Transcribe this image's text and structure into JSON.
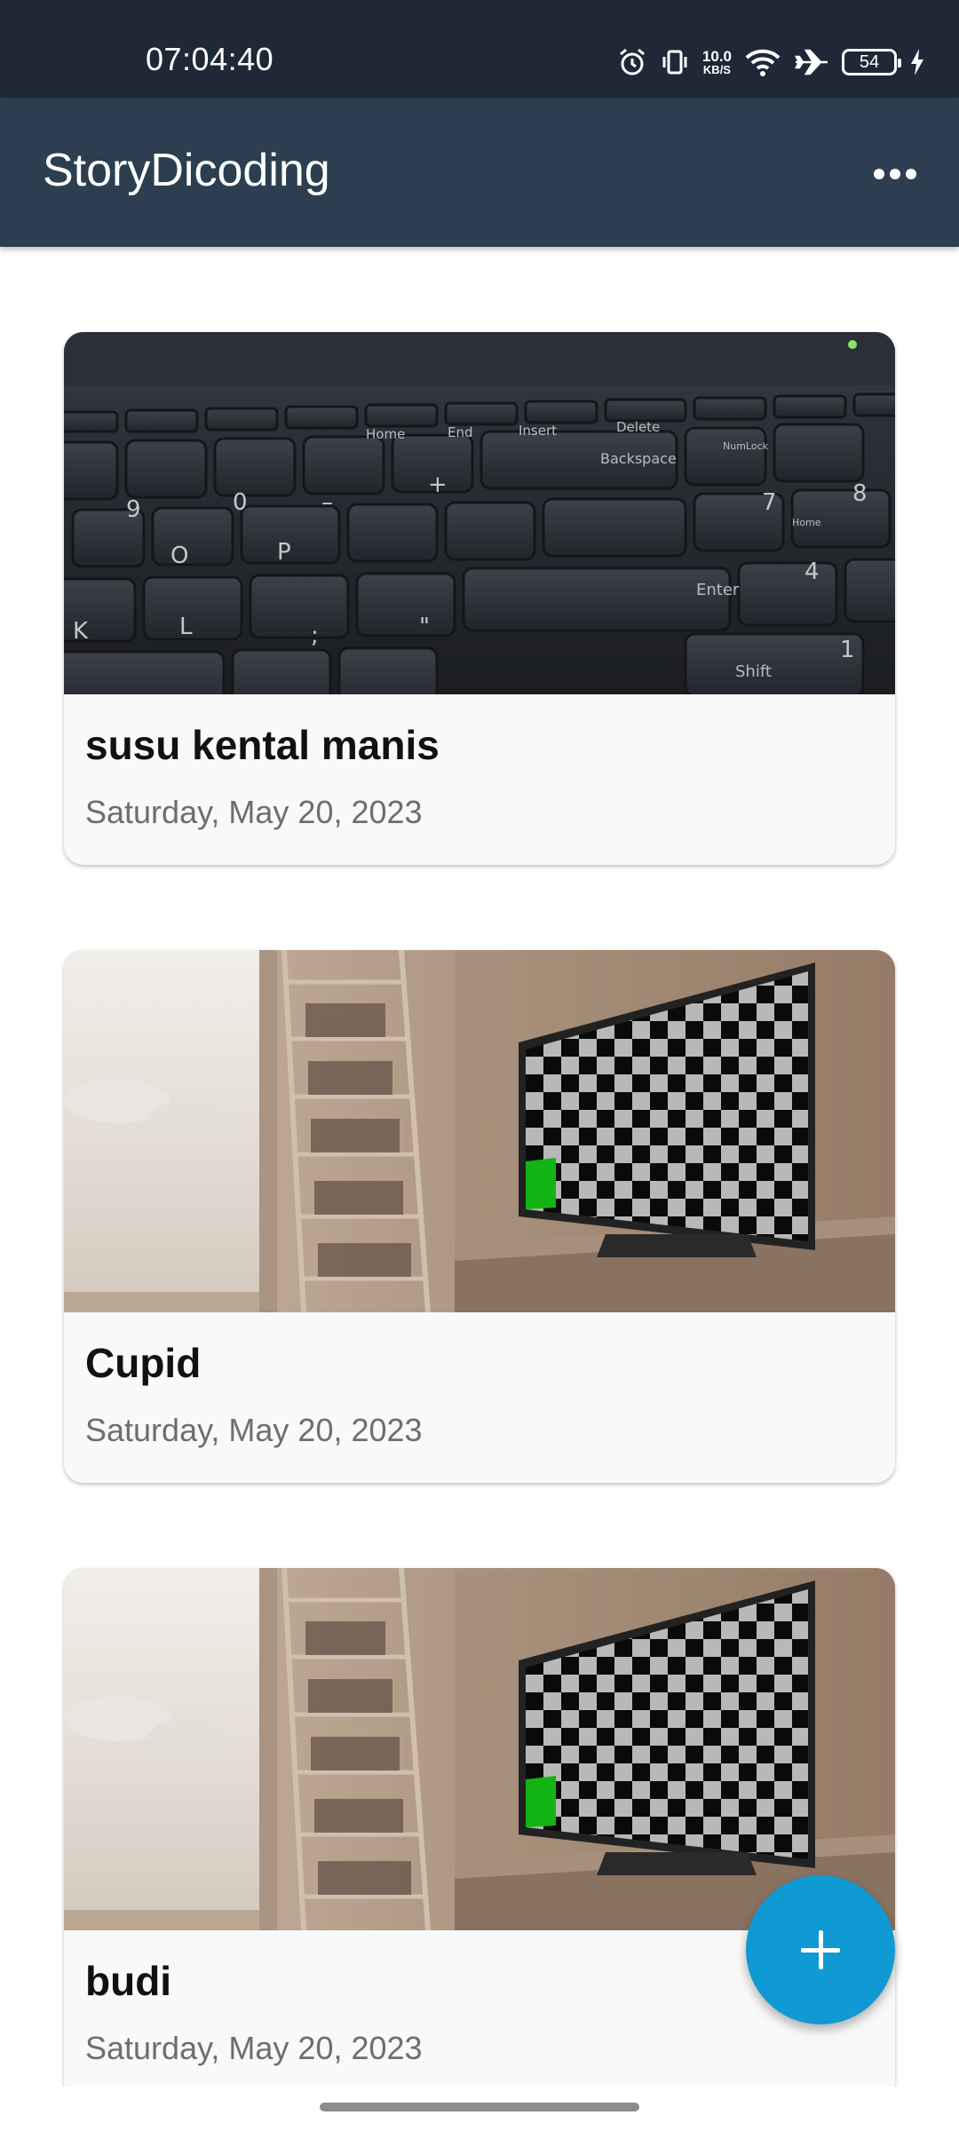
{
  "status_bar": {
    "time": "07:04:40",
    "net_speed_value": "10.0",
    "net_speed_unit": "KB/S",
    "battery": "54",
    "icons": [
      "alarm-icon",
      "vibrate-icon",
      "wifi-icon",
      "airplane-icon",
      "battery-icon",
      "charging-icon"
    ]
  },
  "app_bar": {
    "title": "StoryDicoding",
    "overflow_icon": "more-dots-icon"
  },
  "stories": [
    {
      "name": "susu kental manis",
      "date": "Saturday, May 20, 2023",
      "image": "keyboard-photo"
    },
    {
      "name": "Cupid",
      "date": "Saturday, May 20, 2023",
      "image": "room-tv-checkerboard-photo"
    },
    {
      "name": "budi",
      "date": "Saturday, May 20, 2023",
      "image": "room-tv-checkerboard-photo"
    }
  ],
  "fab": {
    "icon": "add-icon",
    "color": "#0f9ad4"
  },
  "colors": {
    "app_bar": "#2c3e50",
    "status_bar": "#1e2836"
  }
}
